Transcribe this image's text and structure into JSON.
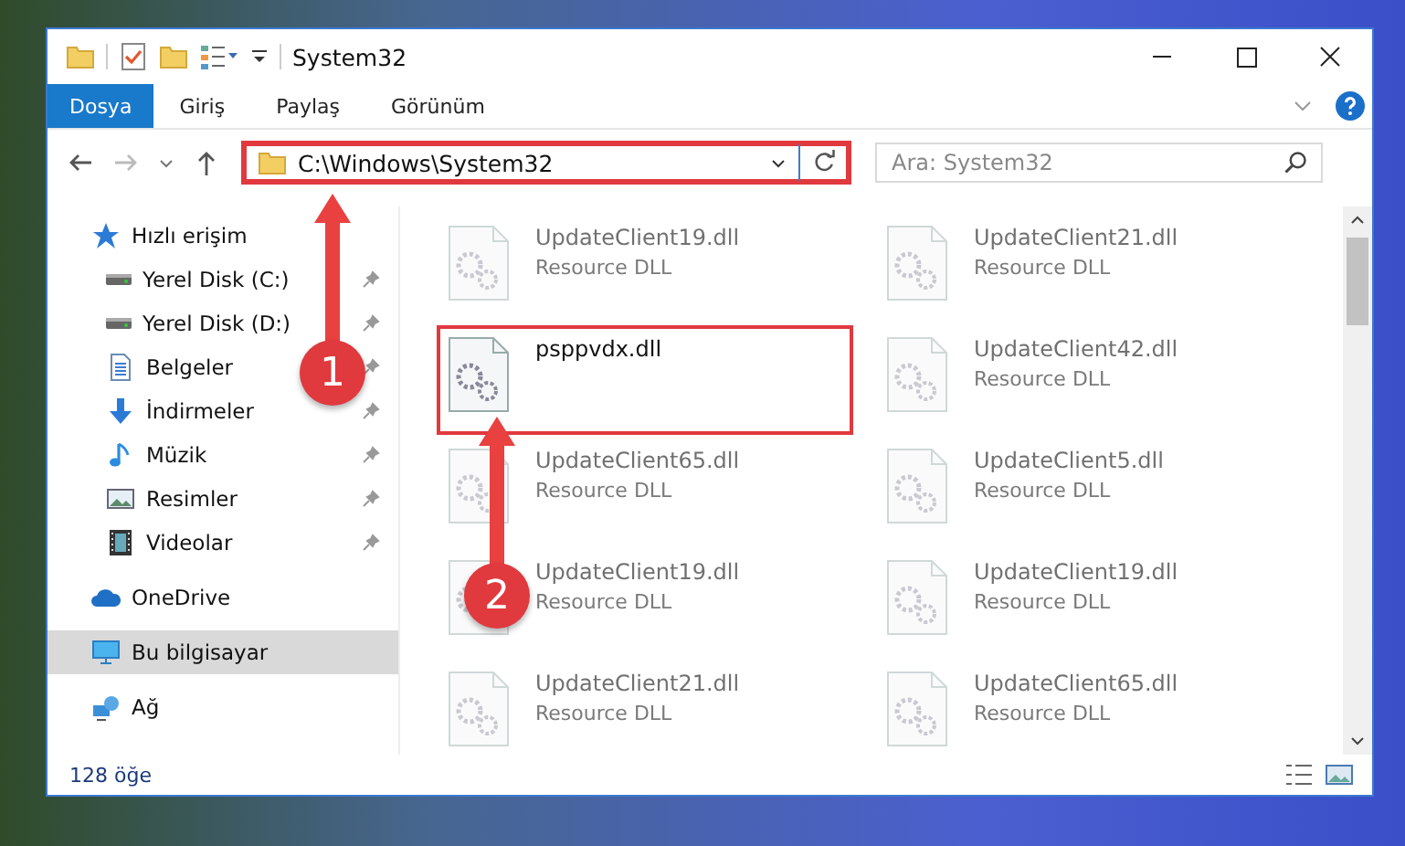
{
  "window": {
    "title": "System32"
  },
  "ribbon_tabs": [
    {
      "label": "Dosya",
      "selected": true
    },
    {
      "label": "Giriş",
      "selected": false
    },
    {
      "label": "Paylaş",
      "selected": false
    },
    {
      "label": "Görünüm",
      "selected": false
    }
  ],
  "address_bar": {
    "path": "C:\\Windows\\System32",
    "highlighted": true
  },
  "search": {
    "placeholder": "Ara: System32"
  },
  "sidebar": {
    "items": [
      {
        "label": "Hızlı erişim",
        "kind": "star",
        "pinned": false,
        "selected": false,
        "children": [
          {
            "label": "Yerel Disk (C:)",
            "kind": "drive",
            "pinned": true,
            "selected": false
          },
          {
            "label": "Yerel Disk (D:)",
            "kind": "drive",
            "pinned": true,
            "selected": false
          },
          {
            "label": "Belgeler",
            "kind": "document",
            "pinned": true,
            "selected": false
          },
          {
            "label": "İndirmeler",
            "kind": "download",
            "pinned": true,
            "selected": false
          },
          {
            "label": "Müzik",
            "kind": "music",
            "pinned": true,
            "selected": false
          },
          {
            "label": "Resimler",
            "kind": "picture",
            "pinned": true,
            "selected": false
          },
          {
            "label": "Videolar",
            "kind": "video",
            "pinned": true,
            "selected": false
          }
        ]
      },
      {
        "label": "OneDrive",
        "kind": "cloud",
        "pinned": false,
        "selected": false
      },
      {
        "label": "Bu bilgisayar",
        "kind": "computer",
        "pinned": false,
        "selected": true
      },
      {
        "label": "Ağ",
        "kind": "network",
        "pinned": false,
        "selected": false
      }
    ]
  },
  "files": [
    {
      "name": "UpdateClient19.dll",
      "type": "Resource DLL",
      "blurred": true,
      "highlighted": false
    },
    {
      "name": "UpdateClient21.dll",
      "type": "Resource DLL",
      "blurred": true,
      "highlighted": false
    },
    {
      "name": "psppvdx.dll",
      "blurred": false,
      "highlighted": true
    },
    {
      "name": "UpdateClient42.dll",
      "type": "Resource DLL",
      "blurred": true,
      "highlighted": false
    },
    {
      "name": "UpdateClient65.dll",
      "type": "Resource DLL",
      "blurred": true,
      "highlighted": false
    },
    {
      "name": "UpdateClient5.dll",
      "type": "Resource DLL",
      "blurred": true,
      "highlighted": false
    },
    {
      "name": "UpdateClient19.dll",
      "type": "Resource DLL",
      "blurred": true,
      "highlighted": false
    },
    {
      "name": "UpdateClient19.dll",
      "type": "Resource DLL",
      "blurred": true,
      "highlighted": false
    },
    {
      "name": "UpdateClient21.dll",
      "type": "Resource DLL",
      "blurred": true,
      "highlighted": false
    },
    {
      "name": "UpdateClient65.dll",
      "type": "Resource DLL",
      "blurred": true,
      "highlighted": false
    }
  ],
  "status_bar": {
    "item_count": "128 öğe"
  },
  "annotations": [
    {
      "label": "1"
    },
    {
      "label": "2"
    }
  ]
}
